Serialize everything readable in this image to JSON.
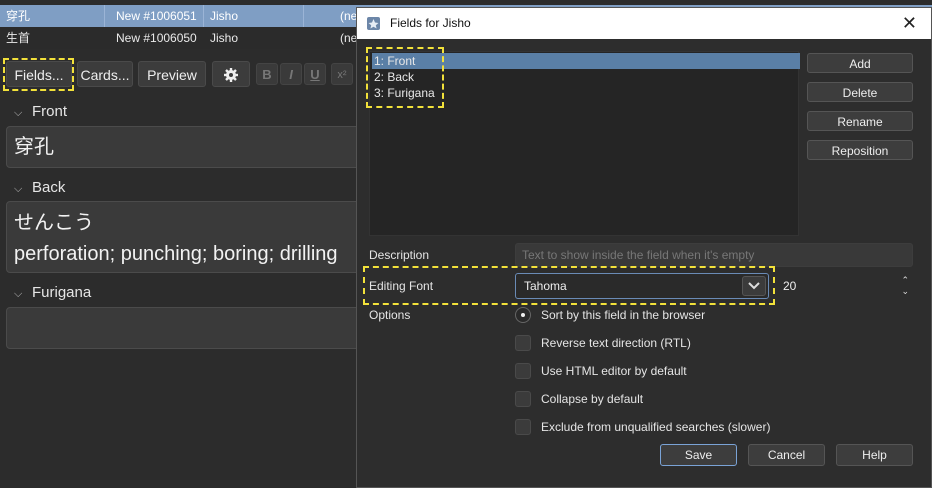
{
  "browser": {
    "rows": [
      {
        "sort_field": "穿孔",
        "note": "New #1006051",
        "note_type": "Jisho",
        "extra": "(ne",
        "selected": true
      },
      {
        "sort_field": "生首",
        "note": "New #1006050",
        "note_type": "Jisho",
        "extra": "(ne",
        "selected": false
      }
    ]
  },
  "editor": {
    "toolbar": {
      "fields_label": "Fields...",
      "cards_label": "Cards...",
      "preview_label": "Preview",
      "bold": "B",
      "italic": "I",
      "underline": "U",
      "superscript": "x²"
    },
    "fields": [
      {
        "label": "Front",
        "value_lines": [
          "穿孔"
        ]
      },
      {
        "label": "Back",
        "value_lines": [
          "せんこう",
          "perforation; punching; boring; drilling"
        ]
      },
      {
        "label": "Furigana",
        "value_lines": []
      }
    ]
  },
  "dialog": {
    "title": "Fields for Jisho",
    "fields_list": [
      "1: Front",
      "2: Back",
      "3: Furigana"
    ],
    "selected_index": 0,
    "buttons": {
      "add": "Add",
      "delete": "Delete",
      "rename": "Rename",
      "reposition": "Reposition"
    },
    "description_label": "Description",
    "description_placeholder": "Text to show inside the field when it's empty",
    "editing_font_label": "Editing Font",
    "editing_font_value": "Tahoma",
    "font_size_value": "20",
    "options_label": "Options",
    "options": [
      {
        "label": "Sort by this field in the browser",
        "type": "radio",
        "checked": true
      },
      {
        "label": "Reverse text direction (RTL)",
        "type": "checkbox",
        "checked": false
      },
      {
        "label": "Use HTML editor by default",
        "type": "checkbox",
        "checked": false
      },
      {
        "label": "Collapse by default",
        "type": "checkbox",
        "checked": false
      },
      {
        "label": "Exclude from unqualified searches (slower)",
        "type": "checkbox",
        "checked": false
      }
    ],
    "footer": {
      "save": "Save",
      "cancel": "Cancel",
      "help": "Help"
    }
  },
  "colors": {
    "selected_row": "#7f9ec4",
    "list_selection": "#5a7fa6",
    "highlight": "#f2e13a",
    "default_button_border": "#7aa3d6"
  }
}
